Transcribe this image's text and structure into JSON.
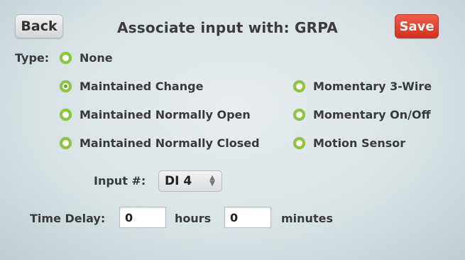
{
  "header": {
    "back_label": "Back",
    "title": "Associate input with: GRPA",
    "save_label": "Save"
  },
  "type_label": "Type:",
  "options": [
    {
      "label": "None",
      "selected": false
    },
    {
      "label": "Maintained Change",
      "selected": true
    },
    {
      "label": "Maintained Normally Open",
      "selected": false
    },
    {
      "label": "Maintained Normally Closed",
      "selected": false
    },
    {
      "label": "Momentary 3-Wire",
      "selected": false
    },
    {
      "label": "Momentary On/Off",
      "selected": false
    },
    {
      "label": "Motion Sensor",
      "selected": false
    }
  ],
  "input": {
    "label": "Input #:",
    "value": "DI 4"
  },
  "time_delay": {
    "label": "Time Delay:",
    "hours_value": "0",
    "hours_unit": "hours",
    "minutes_value": "0",
    "minutes_unit": "minutes"
  },
  "colors": {
    "radio_ring": "#8cc63f",
    "save_button": "#e03a28"
  }
}
